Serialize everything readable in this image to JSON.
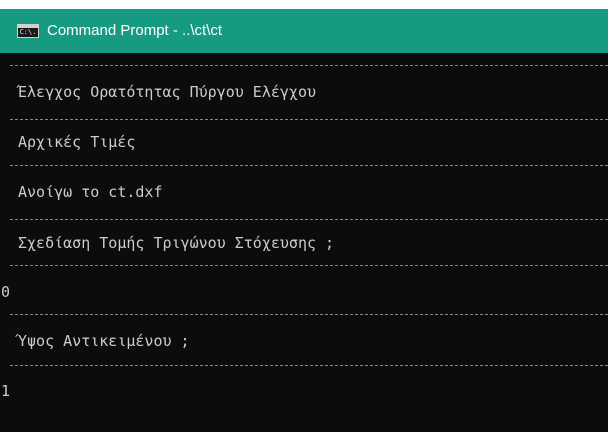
{
  "window": {
    "icon_text": "C:\\.",
    "title": "Command Prompt - ..\\ct\\ct"
  },
  "console": {
    "lines": [
      "Έλεγχος Ορατότητας Πύργου Ελέγχου",
      "Αρχικές Τιμές",
      "Ανοίγω το ct.dxf",
      "Σχεδίαση Τομής Τριγώνου Στόχευσης ;",
      "0",
      "Ύψος Αντικειμένου ;",
      "1"
    ]
  },
  "colors": {
    "titlebar": "#179b80",
    "background": "#0c0c0c",
    "text": "#cccccc"
  }
}
